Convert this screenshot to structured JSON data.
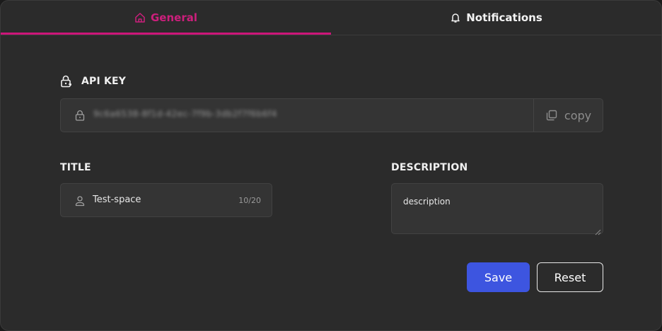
{
  "tabs": [
    {
      "label": "General",
      "icon": "home-icon",
      "active": true
    },
    {
      "label": "Notifications",
      "icon": "bell-icon",
      "active": false
    }
  ],
  "colors": {
    "accent": "#cc1679",
    "primary_button": "#3d55e0",
    "panel_bg": "#2b2b2b",
    "field_bg": "#343434"
  },
  "api_key": {
    "label": "API KEY",
    "icon": "lock-icon",
    "value": "9c6a6538-8f1d-42ec-7f9b-3db2f7f6b6f4",
    "copy_label": "copy",
    "copy_icon": "copy-icon"
  },
  "title_field": {
    "label": "TITLE",
    "icon": "user-icon",
    "value": "Test-space",
    "counter": "10/20"
  },
  "description_field": {
    "label": "DESCRIPTION",
    "value": "description"
  },
  "actions": {
    "save_label": "Save",
    "reset_label": "Reset"
  }
}
